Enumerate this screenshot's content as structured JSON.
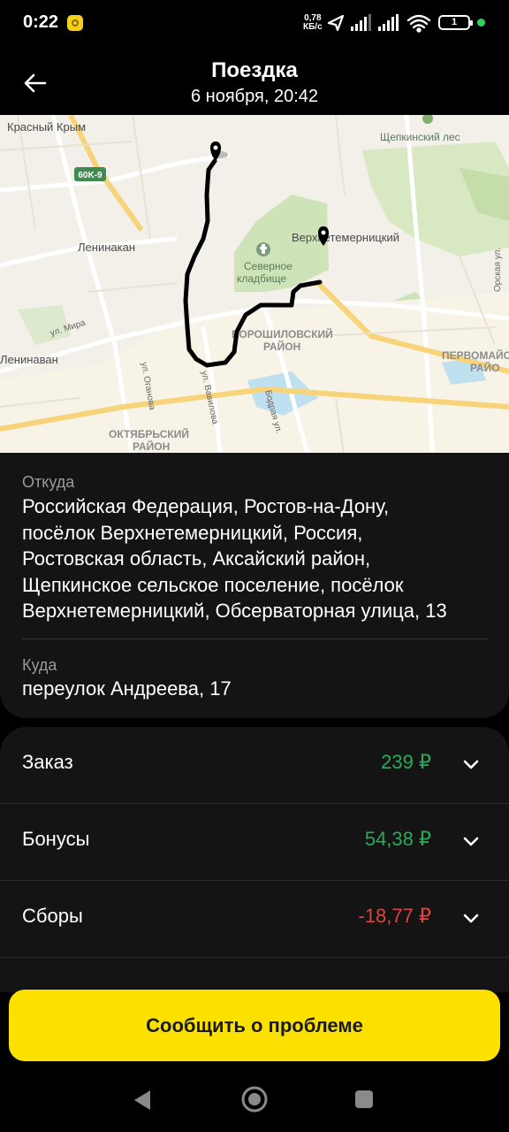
{
  "status": {
    "time": "0:22",
    "speed_value": "0,78",
    "speed_unit": "КБ/с",
    "battery": "1",
    "icons": [
      "location-arrow-icon",
      "signal-icon",
      "signal-icon",
      "wifi-icon",
      "battery-icon"
    ]
  },
  "header": {
    "title": "Поездка",
    "subtitle": "6 ноября, 20:42",
    "back_icon": "arrow-left-icon"
  },
  "map": {
    "labels": {
      "krasny_krym": "Красный Крым",
      "shchepkinsky_les": "Щепкинский лес",
      "road_60k9": "60K-9",
      "leninakan": "Ленинакан",
      "verkhnetemernitsky": "Верхнетемерницкий",
      "cemetery_1": "Северное",
      "cemetery_2": "кладбище",
      "mira": "ул. Мира",
      "voroshilovsky_1": "ВОРОШИЛОВСКИЙ",
      "voroshilovsky_2": "РАЙОН",
      "leninavan": "Ленинаван",
      "oganova": "ул. Оганова",
      "vavilova": "ул. Вавилова",
      "bodraya": "Бодрая ул.",
      "oktyabrsky_1": "ОКТЯБРЬСКИЙ",
      "oktyabrsky_2": "РАЙОН",
      "pervomaysky_1": "ПЕРВОМАЙС",
      "pervomaysky_2": "РАЙО",
      "orskaya": "Орская ул."
    },
    "route_color": "#000000"
  },
  "trip": {
    "from_label": "Откуда",
    "from_lines": [
      "Российская Федерация, Ростов-на-Дону,",
      "посёлок Верхнетемерницкий, Россия,",
      "Ростовская область, Аксайский район,",
      "Щепкинское сельское поселение, посёлок",
      "Верхнетемерницкий, Обсерваторная улица, 13"
    ],
    "to_label": "Куда",
    "to_address": "переулок Андреева, 17"
  },
  "payment": {
    "rows": [
      {
        "label": "Заказ",
        "value": "239 ₽",
        "color": "#2bab5a"
      },
      {
        "label": "Бонусы",
        "value": "54,38 ₽",
        "color": "#2bab5a"
      },
      {
        "label": "Сборы",
        "value": "-18,77 ₽",
        "color": "#e2443d"
      }
    ]
  },
  "action": {
    "report_label": "Сообщить о проблеме",
    "accent": "#fce000"
  },
  "navbar": {
    "icons": [
      "nav-back-icon",
      "nav-home-icon",
      "nav-recents-icon"
    ]
  }
}
